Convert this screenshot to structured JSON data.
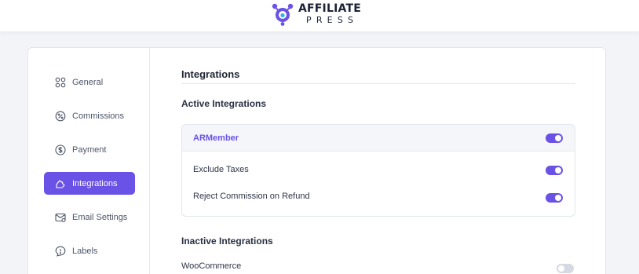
{
  "brand": {
    "name_line1": "AFFILIATE",
    "name_line2": "PRESS",
    "accent_color": "#6a52e6"
  },
  "sidebar": {
    "items": [
      {
        "label": "General",
        "icon": "grid-icon",
        "active": false
      },
      {
        "label": "Commissions",
        "icon": "percent-badge-icon",
        "active": false
      },
      {
        "label": "Payment",
        "icon": "dollar-circle-icon",
        "active": false
      },
      {
        "label": "Integrations",
        "icon": "puzzle-icon",
        "active": true
      },
      {
        "label": "Email Settings",
        "icon": "mail-settings-icon",
        "active": false
      },
      {
        "label": "Labels",
        "icon": "chat-alert-icon",
        "active": false
      }
    ]
  },
  "main": {
    "title": "Integrations",
    "active_section_title": "Active Integrations",
    "active_integration": {
      "name": "ARMember",
      "enabled": true,
      "options": [
        {
          "label": "Exclude Taxes",
          "enabled": true
        },
        {
          "label": "Reject Commission on Refund",
          "enabled": true
        }
      ]
    },
    "inactive_section_title": "Inactive Integrations",
    "inactive_integrations": [
      {
        "name": "WooCommerce",
        "enabled": false
      }
    ]
  }
}
